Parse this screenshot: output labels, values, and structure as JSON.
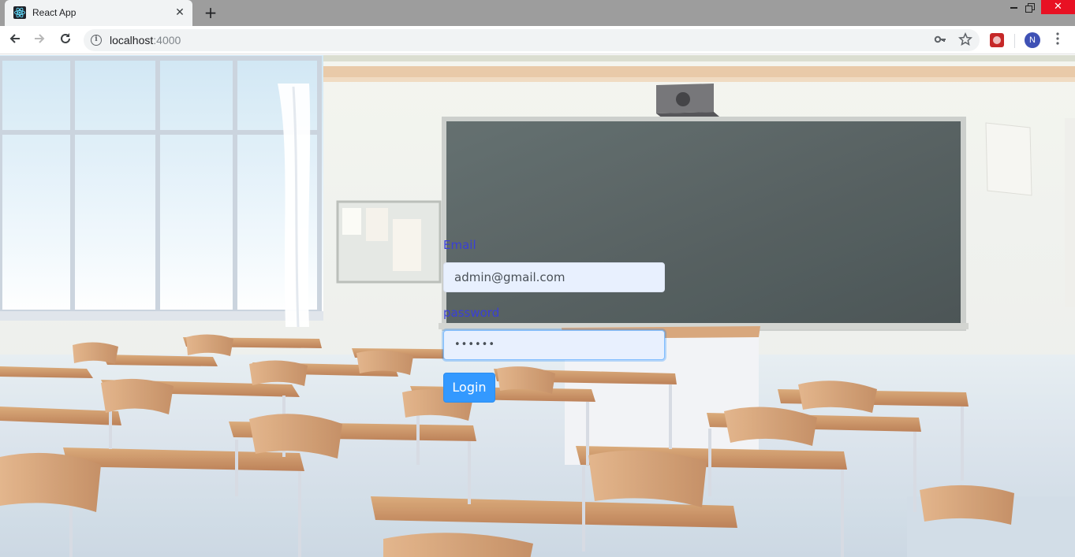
{
  "browser": {
    "tab_title": "React App",
    "tab_close_glyph": "✕",
    "new_tab_glyph": "+",
    "url_host": "localhost",
    "url_port": ":4000",
    "profile_initial": "N",
    "window_close_glyph": "✕"
  },
  "login": {
    "email_label": "Email",
    "email_value": "admin@gmail.com",
    "password_label": "password",
    "password_mask": "••••••",
    "submit_label": "Login"
  },
  "theme": {
    "label_color": "#3a3fd6",
    "button_color": "#3399ff",
    "input_autofill_bg": "#e8f0fe"
  }
}
